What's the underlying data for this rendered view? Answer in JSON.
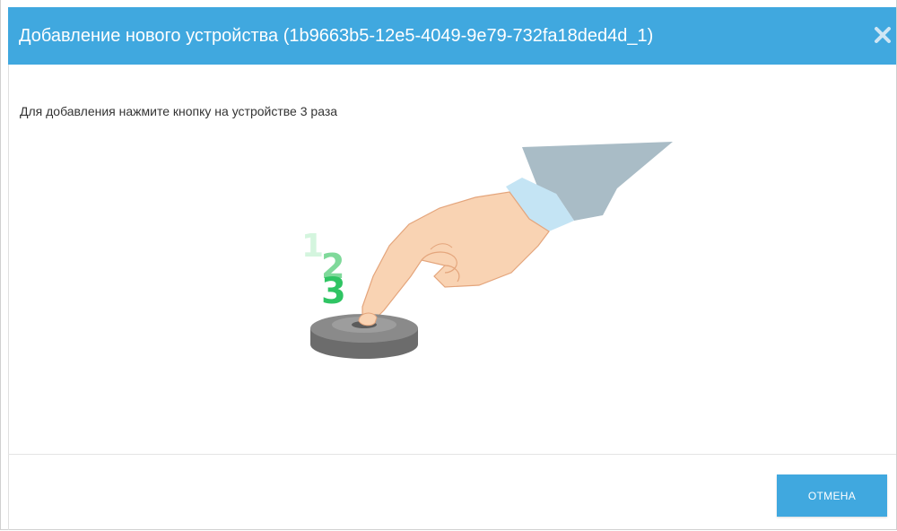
{
  "dialog": {
    "title": "Добавление нового устройства (1b9663b5-12e5-4049-9e79-732fa18ded4d_1)",
    "close_icon": "close-icon",
    "instruction": "Для добавления нажмите кнопку на устройстве 3 раза",
    "illustration": {
      "counts": [
        "1",
        "2",
        "3"
      ],
      "count_colors": [
        "#d4f5de",
        "#7fd99a",
        "#2fc463"
      ]
    },
    "cancel_label": "ОТМЕНА"
  },
  "colors": {
    "accent": "#40a8df"
  }
}
